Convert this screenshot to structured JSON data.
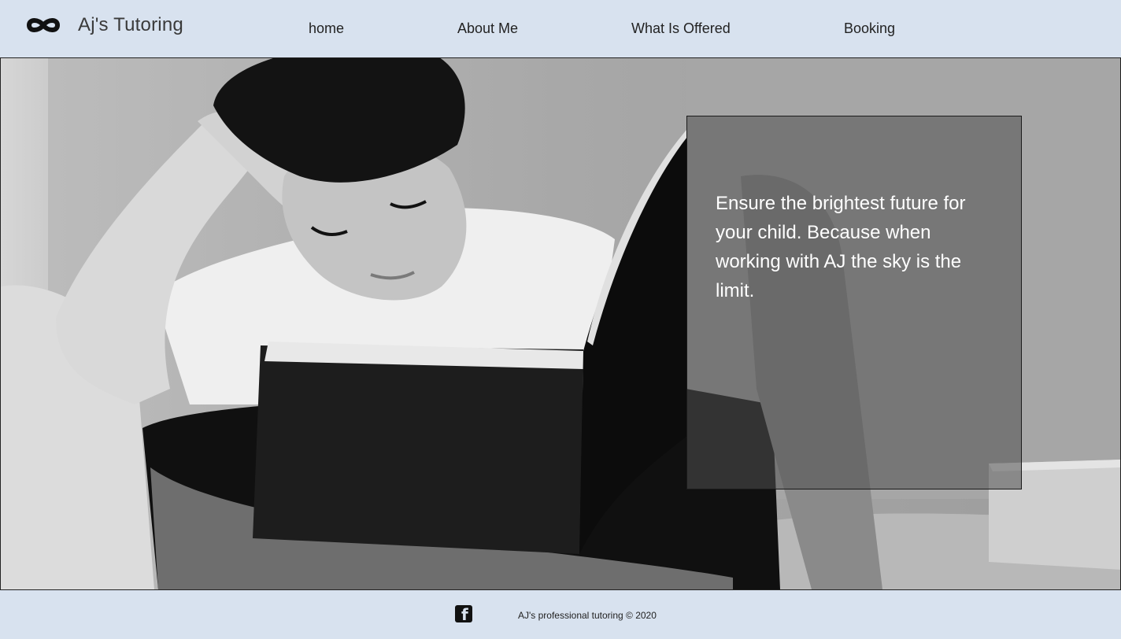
{
  "header": {
    "logo_icon": "infinity-icon",
    "brand": "Aj's Tutoring",
    "nav": [
      {
        "label": "home"
      },
      {
        "label": "About Me"
      },
      {
        "label": "What Is Offered"
      },
      {
        "label": "Booking"
      }
    ]
  },
  "hero": {
    "image_subject": "boy reading a book",
    "overlay_text": "Ensure the brightest future for your child. Because when working with AJ the sky is the limit."
  },
  "footer": {
    "social_icon": "facebook-icon",
    "copyright": "AJ's professional tutoring © 2020"
  },
  "colors": {
    "header_bg": "#d8e2ef",
    "footer_bg": "#d8e2ef",
    "overlay_text": "#ffffff"
  }
}
